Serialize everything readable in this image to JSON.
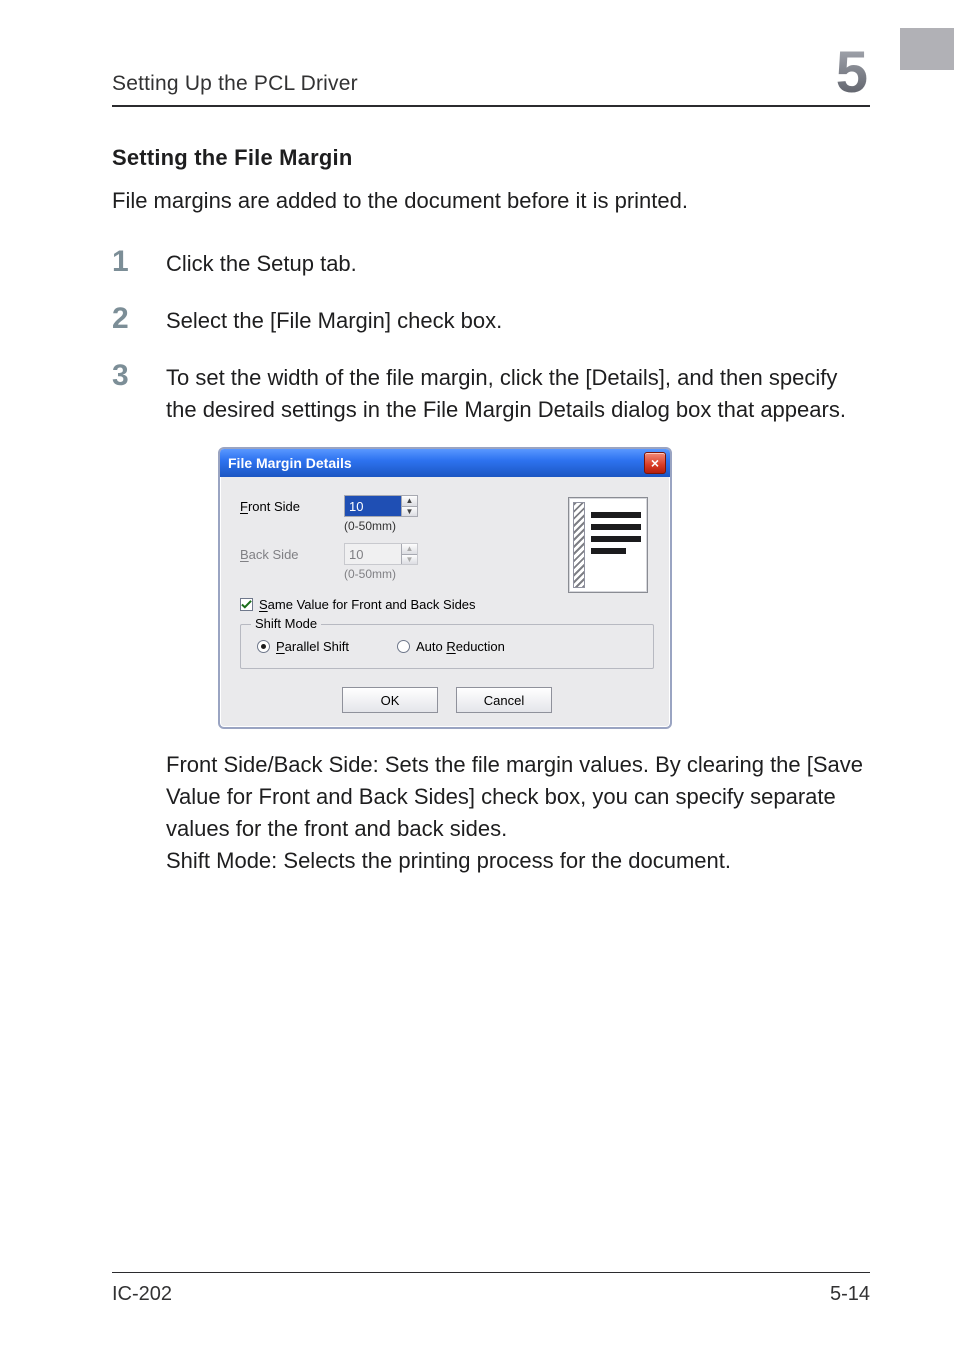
{
  "header": {
    "running_head": "Setting Up the PCL Driver",
    "chapter_number": "5"
  },
  "section_heading": "Setting the File Margin",
  "intro": "File margins are added to the document before it is printed.",
  "steps": [
    {
      "text": "Click the Setup tab."
    },
    {
      "text": "Select the [File Margin] check box."
    },
    {
      "text": "To set the width of the file margin, click the [Details], and then specify the desired settings in the File Margin Details dialog box that appears."
    }
  ],
  "dialog": {
    "title": "File Margin Details",
    "close_label": "×",
    "fields": {
      "front": {
        "label": "Front Side",
        "accesskey": "F",
        "value": "10",
        "range": "(0-50mm)"
      },
      "back": {
        "label": "Back Side",
        "accesskey": "B",
        "value": "10",
        "range": "(0-50mm)",
        "disabled": true
      }
    },
    "same_value": {
      "label": "Same Value for Front and Back Sides",
      "accesskey": "S",
      "checked": true
    },
    "shift_mode": {
      "legend": "Shift Mode",
      "options": [
        {
          "label": "Parallel Shift",
          "accesskey": "P",
          "selected": true
        },
        {
          "label": "Auto Reduction",
          "accesskey": "R",
          "selected": false
        }
      ]
    },
    "buttons": {
      "ok": "OK",
      "cancel": "Cancel"
    }
  },
  "explanation": {
    "line1": "Front Side/Back Side: Sets the file margin values. By clearing the [Save Value for Front and Back Sides] check box, you can specify separate values for the front and back sides.",
    "line2": "Shift Mode: Selects the printing process for the document."
  },
  "footer": {
    "left": "IC-202",
    "right": "5-14"
  }
}
